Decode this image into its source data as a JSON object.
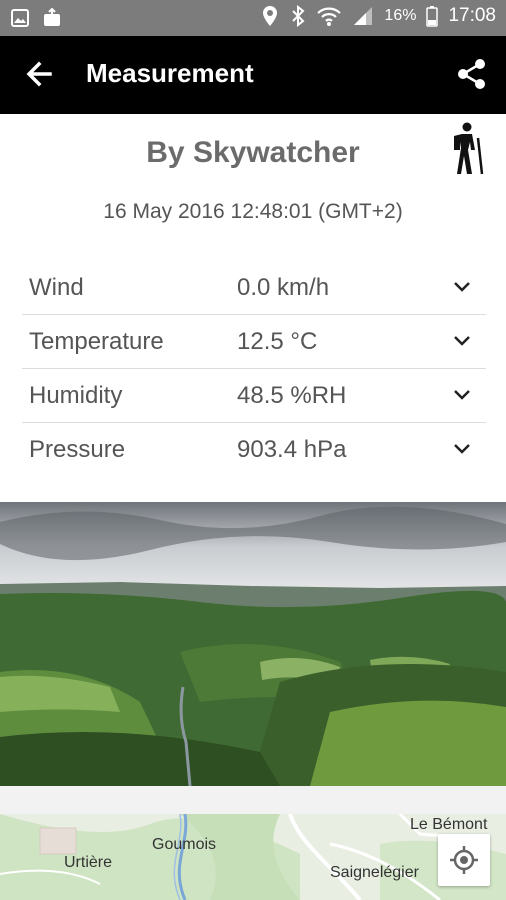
{
  "status_bar": {
    "battery": "16%",
    "time": "17:08",
    "icons": [
      "gallery-icon",
      "image-upload-icon",
      "location-icon",
      "bluetooth-icon",
      "wifi-icon",
      "signal-icon",
      "battery-icon"
    ]
  },
  "app_bar": {
    "title": "Measurement",
    "back_icon": "arrow-left-icon",
    "share_icon": "share-icon"
  },
  "measurement": {
    "author": "By Skywatcher",
    "activity_icon": "hiker-icon",
    "datetime": "16 May 2016 12:48:01 (GMT+2)",
    "rows": [
      {
        "label": "Wind",
        "value": "0.0 km/h"
      },
      {
        "label": "Temperature",
        "value": "12.5 °C"
      },
      {
        "label": "Humidity",
        "value": "48.5 %RH"
      },
      {
        "label": "Pressure",
        "value": "903.4 hPa"
      }
    ]
  },
  "map": {
    "labels": [
      "Le Bémont",
      "Goumois",
      "Urtière",
      "Saignelégier"
    ],
    "locate_icon": "my-location-icon"
  },
  "colors": {
    "status_bar": "#7c7c7c",
    "app_bar": "#000000",
    "text": "#555555"
  }
}
